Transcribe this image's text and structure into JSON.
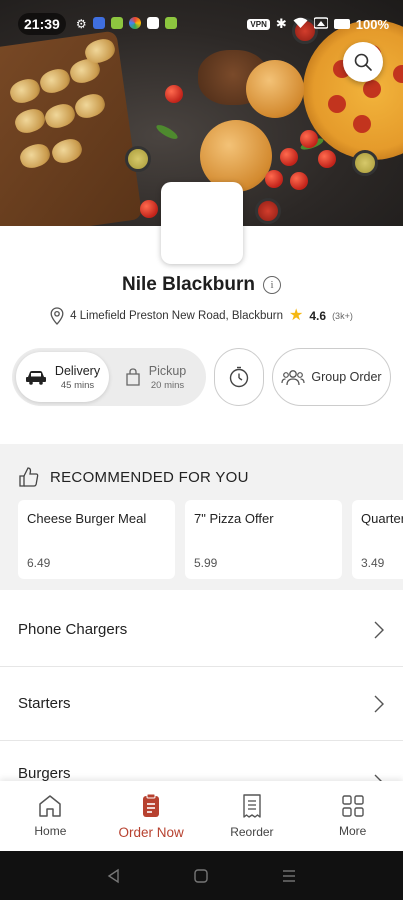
{
  "status_bar": {
    "time": "21:39",
    "battery": "100%",
    "vpn_label": "VPN"
  },
  "restaurant": {
    "name": "Nile Blackburn",
    "address": "4 Limefield Preston New Road, Blackburn",
    "rating": "4.6",
    "rating_count": "(3k+)"
  },
  "order_modes": {
    "delivery": {
      "label": "Delivery",
      "time": "45 mins",
      "selected": true
    },
    "pickup": {
      "label": "Pickup",
      "time": "20 mins",
      "selected": false
    },
    "group_order_label": "Group Order"
  },
  "recommended": {
    "heading": "RECOMMENDED FOR YOU",
    "items": [
      {
        "name": "Cheese Burger Meal",
        "price": "6.49"
      },
      {
        "name": "7\" Pizza Offer",
        "price": "5.99"
      },
      {
        "name": "Quarter Pounder Cheese",
        "price": "3.49"
      }
    ]
  },
  "categories": [
    {
      "name": "Phone Chargers"
    },
    {
      "name": "Starters"
    },
    {
      "name": "Burgers"
    }
  ],
  "bottom_nav": {
    "items": [
      {
        "label": "Home",
        "icon": "home-icon",
        "active": false
      },
      {
        "label": "Order Now",
        "icon": "order-icon",
        "active": true
      },
      {
        "label": "Reorder",
        "icon": "receipt-icon",
        "active": false
      },
      {
        "label": "More",
        "icon": "grid-icon",
        "active": false
      }
    ]
  },
  "colors": {
    "accent": "#b7412f",
    "star": "#f5b814",
    "section_bg": "#f2f2f2"
  }
}
